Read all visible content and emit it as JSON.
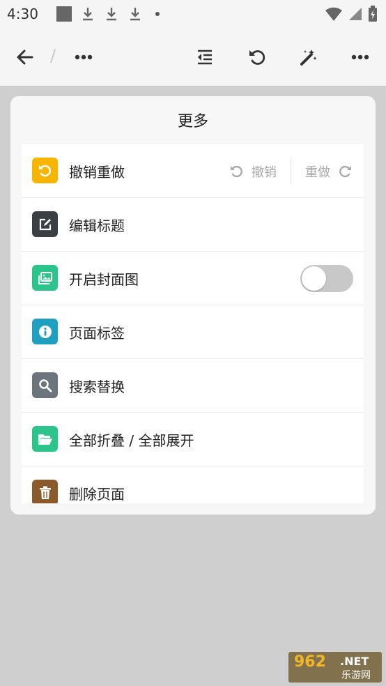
{
  "status": {
    "time": "4:30"
  },
  "toolbar": {
    "back_icon": "arrow-left-icon",
    "separator": "/",
    "more_icon": "more-horizontal-icon",
    "outline_icon": "indent-icon",
    "undo_icon": "undo-icon",
    "magic_icon": "magic-wand-icon",
    "more2_icon": "more-horizontal-icon"
  },
  "panel": {
    "title": "更多",
    "items": [
      {
        "label": "撤销重做",
        "icon": "undo-icon",
        "color": "#f7b500"
      },
      {
        "label": "编辑标题",
        "icon": "edit-icon",
        "color": "#3a3f44"
      },
      {
        "label": "开启封面图",
        "icon": "image-icon",
        "color": "#2bc48a",
        "toggle": false
      },
      {
        "label": "页面标签",
        "icon": "info-icon",
        "color": "#1fa0c0"
      },
      {
        "label": "搜索替换",
        "icon": "search-icon",
        "color": "#6c757d"
      },
      {
        "label": "全部折叠 / 全部展开",
        "icon": "folder-open-icon",
        "color": "#2bc48a"
      },
      {
        "label": "删除页面",
        "icon": "trash-icon",
        "color": "#8a5a2b"
      }
    ],
    "undo_label": "撤销",
    "redo_label": "重做"
  },
  "watermark": {
    "brand": "962",
    "net": ".NET",
    "cn": "乐游网"
  }
}
